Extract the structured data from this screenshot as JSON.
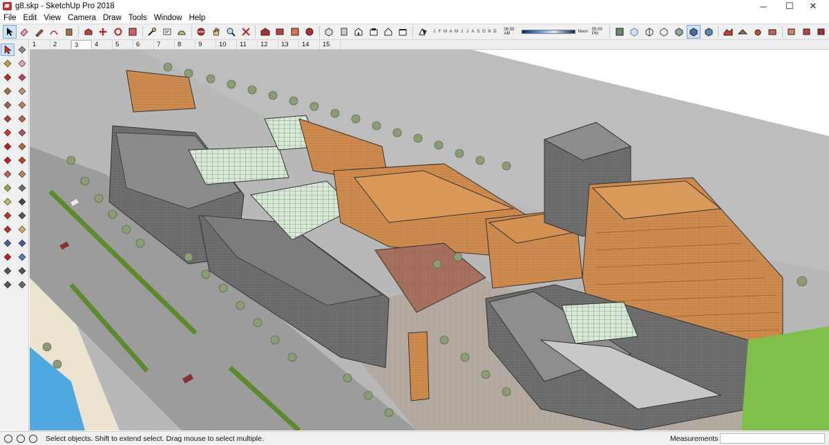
{
  "window": {
    "title": "g8.skp - SketchUp Pro 2018",
    "minimize_glyph": "─",
    "maximize_glyph": "☐",
    "close_glyph": "✕"
  },
  "menu": [
    "File",
    "Edit",
    "View",
    "Camera",
    "Draw",
    "Tools",
    "Window",
    "Help"
  ],
  "toolbar": {
    "shadow_months": [
      "J",
      "F",
      "M",
      "A",
      "M",
      "J",
      "J",
      "A",
      "S",
      "O",
      "N",
      "D"
    ],
    "shadow_time_start": "06:55 AM",
    "shadow_time_noon": "Noon",
    "shadow_time_end": "05:00 PM"
  },
  "scene_tabs": [
    "1",
    "2",
    "3",
    "4",
    "5",
    "6",
    "7",
    "8",
    "9",
    "10",
    "11",
    "12",
    "13",
    "14",
    "15"
  ],
  "active_scene": "3",
  "status": {
    "message": "Select objects. Shift to extend select. Drag mouse to select multiple.",
    "measurements_label": "Measurements",
    "measurements_value": ""
  },
  "colors": {
    "roof_orange": "#d49152",
    "wall_orange": "#c8814a",
    "roof_gray": "#7a7a7a",
    "glass": "#d9ecd9",
    "plaza": "#b6aba3",
    "road": "#9a9a9a",
    "grass": "#7fbf4a",
    "tree": "#8a9a72",
    "water": "#4fa8e0"
  },
  "icons": {
    "toolbar": [
      "select-icon",
      "eraser-icon",
      "pencil-icon",
      "arc-icon",
      "paint-bucket-icon",
      "push-pull-icon",
      "move-icon",
      "rotate-icon",
      "scale-icon",
      "offset-icon",
      "tape-measure-icon",
      "text-icon",
      "orbit-icon",
      "pan-icon",
      "zoom-icon",
      "zoom-extents-icon",
      "warehouse-icon",
      "extension-icon",
      "layout-icon",
      "iso-view-icon",
      "top-view-icon",
      "front-view-icon",
      "right-view-icon",
      "back-view-icon",
      "left-view-icon",
      "xray-icon",
      "wireframe-icon",
      "hidden-line-icon",
      "shaded-icon",
      "textured-icon",
      "monochrome-icon",
      "section-plane-icon",
      "sandbox-icon"
    ],
    "palette": [
      "select-icon",
      "component-icon",
      "paint-bucket-icon",
      "eraser-icon",
      "line-icon",
      "freehand-icon",
      "rectangle-icon",
      "rotated-rectangle-icon",
      "circle-icon",
      "polygon-icon",
      "arc-icon",
      "pie-icon",
      "three-point-arc-icon",
      "two-point-arc-icon",
      "move-icon",
      "push-pull-icon",
      "rotate-icon",
      "follow-me-icon",
      "scale-icon",
      "offset-icon",
      "tape-measure-icon",
      "dimension-icon",
      "protractor-icon",
      "text-icon",
      "axes-icon",
      "3d-text-icon",
      "orbit-icon",
      "pan-icon",
      "zoom-icon",
      "zoom-window-icon",
      "zoom-extents-icon",
      "previous-view-icon",
      "position-camera-icon",
      "look-around-icon",
      "walk-icon",
      "section-plane-icon"
    ]
  }
}
